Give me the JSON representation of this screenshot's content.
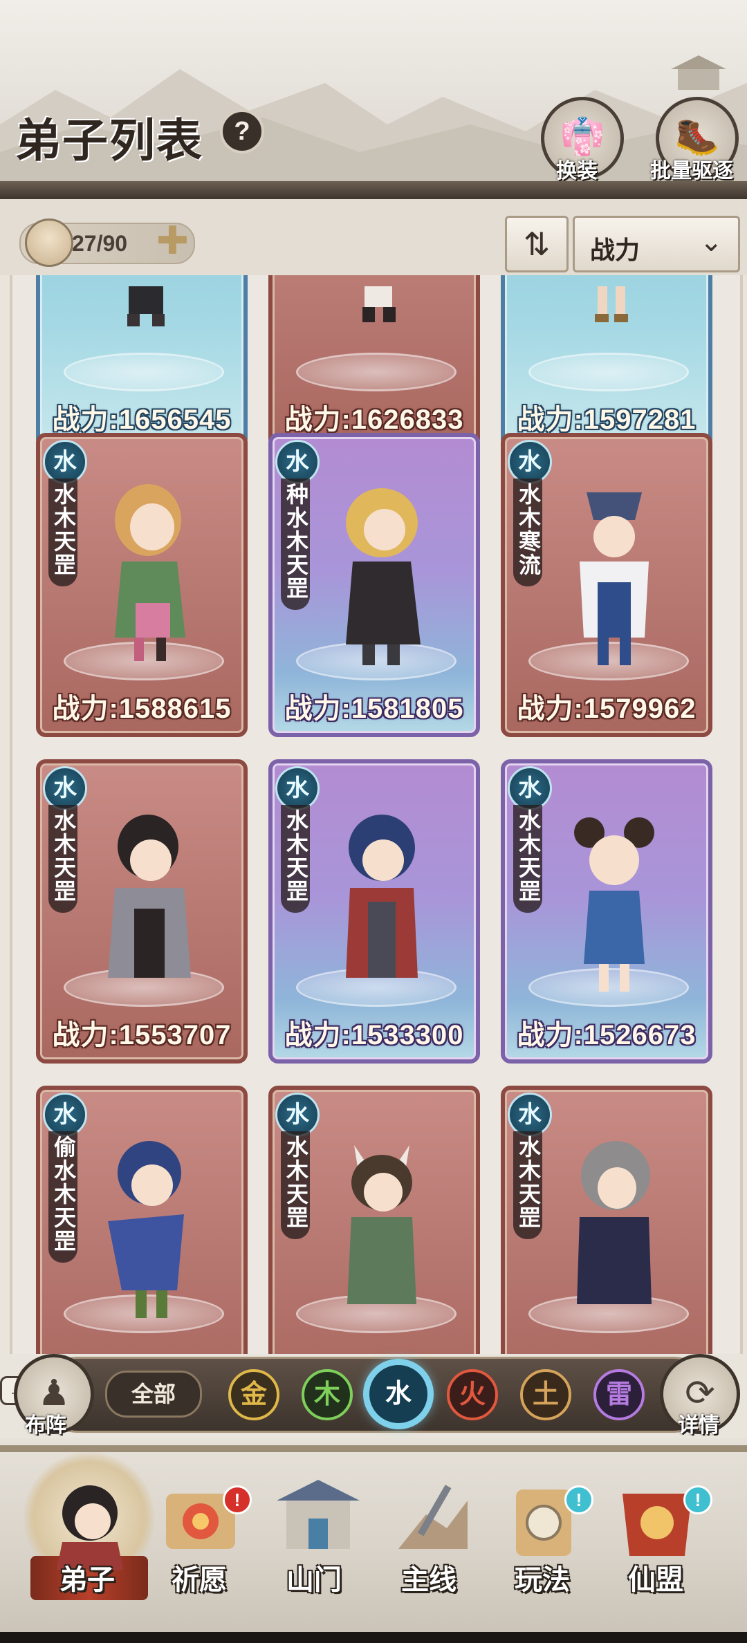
{
  "header": {
    "title": "弟子列表",
    "help_icon": "?",
    "buttons": [
      {
        "label": "换装",
        "icon": "outfit-icon"
      },
      {
        "label": "批量驱逐",
        "icon": "expel-icon"
      }
    ]
  },
  "count_bar": {
    "count": "27/90",
    "add_icon": "plus-icon",
    "sort_icon": "sort-arrows-icon",
    "sort_value": "战力",
    "sort_chevron": "chevron-down-icon"
  },
  "cards": [
    {
      "power": "战力:1656545",
      "element": "",
      "name": "",
      "style": "blue"
    },
    {
      "power": "战力:1626833",
      "element": "",
      "name": "",
      "style": "red"
    },
    {
      "power": "战力:1597281",
      "element": "",
      "name": "",
      "style": "blue"
    },
    {
      "power": "战力:1588615",
      "element": "水",
      "name": "水木天罡",
      "style": "red"
    },
    {
      "power": "战力:1581805",
      "element": "水",
      "name": "种水木天罡",
      "style": "purple"
    },
    {
      "power": "战力:1579962",
      "element": "水",
      "name": "水木寒流",
      "style": "red"
    },
    {
      "power": "战力:1553707",
      "element": "水",
      "name": "水木天罡",
      "style": "red"
    },
    {
      "power": "战力:1533300",
      "element": "水",
      "name": "水木天罡",
      "style": "purple"
    },
    {
      "power": "战力:1526673",
      "element": "水",
      "name": "水木天罡",
      "style": "purple"
    },
    {
      "power": "",
      "element": "水",
      "name": "偷水木天罡",
      "style": "red"
    },
    {
      "power": "",
      "element": "水",
      "name": "水木天罡",
      "style": "red"
    },
    {
      "power": "",
      "element": "水",
      "name": "水木天罡",
      "style": "red"
    }
  ],
  "filter": {
    "left_button": "布阵",
    "right_button": "详情",
    "all_label": "全部",
    "elements": [
      {
        "label": "金",
        "color": "#e0b84a",
        "bg": "#3b2f1d"
      },
      {
        "label": "木",
        "color": "#7fcf5b",
        "bg": "#22311c"
      },
      {
        "label": "水",
        "color": "#7fd0ea",
        "bg": "#163e52",
        "selected": true
      },
      {
        "label": "火",
        "color": "#e2583f",
        "bg": "#3b1e19"
      },
      {
        "label": "土",
        "color": "#d6a35a",
        "bg": "#3a2a1b"
      },
      {
        "label": "雷",
        "color": "#b57be0",
        "bg": "#2b1f3a"
      }
    ]
  },
  "nav": {
    "items": [
      {
        "label": "弟子",
        "active": true
      },
      {
        "label": "祈愿",
        "badge": "!"
      },
      {
        "label": "山门"
      },
      {
        "label": "主线"
      },
      {
        "label": "玩法",
        "badge": "!"
      },
      {
        "label": "仙盟",
        "badge": "!"
      }
    ]
  },
  "colors": {
    "accent_water": "#7fd0ea",
    "card_red": "#b67670",
    "card_purple": "#a995d9",
    "card_blue": "#a4d8e4",
    "badge_red": "#d6302a",
    "badge_cyan": "#3fbfd0"
  }
}
